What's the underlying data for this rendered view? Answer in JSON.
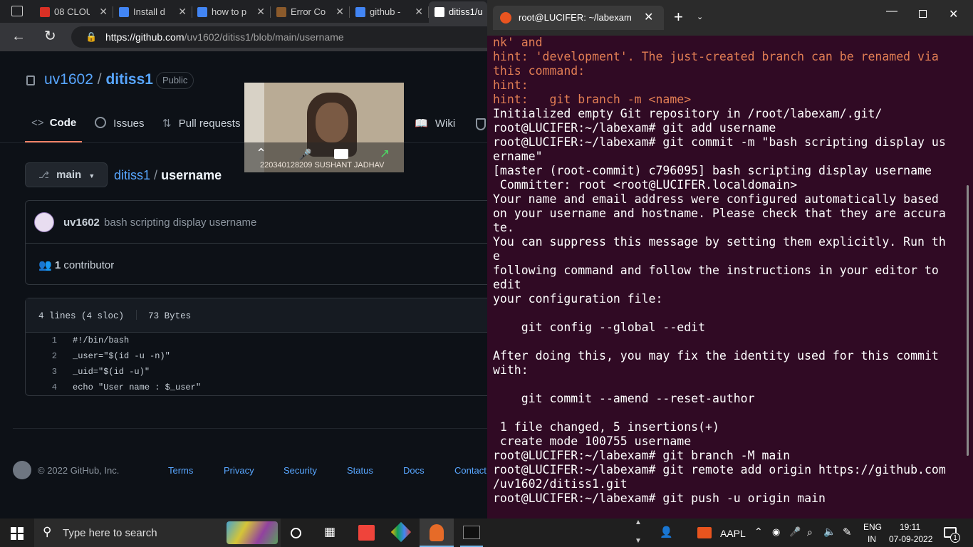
{
  "browser": {
    "tabs": [
      {
        "label": "08 CLOU",
        "icon": "pdf-icon",
        "color": "#d93025"
      },
      {
        "label": "Install d",
        "icon": "search-icon",
        "color": "#4285f4"
      },
      {
        "label": "how to p",
        "icon": "search-icon",
        "color": "#4285f4"
      },
      {
        "label": "Error Co",
        "icon": "page-icon",
        "color": "#8b5a2b"
      },
      {
        "label": "github -",
        "icon": "search-icon",
        "color": "#4285f4"
      },
      {
        "label": "ditiss1/u",
        "icon": "github-icon",
        "color": "#ffffff"
      }
    ],
    "url_host": "https://github.com",
    "url_path": "/uv1602/ditiss1/blob/main/username"
  },
  "github": {
    "owner": "uv1602",
    "sep": "/",
    "repo": "ditiss1",
    "visibility": "Public",
    "nav": {
      "code": "Code",
      "issues": "Issues",
      "pulls": "Pull requests",
      "wiki": "Wiki"
    },
    "branch": "main",
    "breadcrumb_repo": "ditiss1",
    "breadcrumb_file": "username",
    "commit_author": "uv1602",
    "commit_message": "bash scripting display username",
    "contributors_count": "1",
    "contributors_label": "contributor",
    "file_lines": "4 lines (4 sloc)",
    "file_size": "73 Bytes",
    "code": [
      {
        "n": "1",
        "text": "#!/bin/bash"
      },
      {
        "n": "2",
        "text": "_user=\"$(id -u -n)\""
      },
      {
        "n": "3",
        "text": "_uid=\"$(id -u)\""
      },
      {
        "n": "4",
        "text": "echo \"User name : $_user\""
      }
    ],
    "footer": {
      "copyright": "© 2022 GitHub, Inc.",
      "links": [
        "Terms",
        "Privacy",
        "Security",
        "Status",
        "Docs",
        "Contact"
      ]
    }
  },
  "video": {
    "caption": "220340128209 SUSHANT JADHAV"
  },
  "terminal": {
    "title": "root@LUCIFER: ~/labexam",
    "lines": [
      {
        "t": "nk' and",
        "c": "hint"
      },
      {
        "t": "hint: 'development'. The just-created branch can be renamed via",
        "c": "hint"
      },
      {
        "t": "this command:",
        "c": "hint"
      },
      {
        "t": "hint:",
        "c": "hint"
      },
      {
        "t": "hint:   git branch -m <name>",
        "c": "hint"
      },
      {
        "t": "Initialized empty Git repository in /root/labexam/.git/",
        "c": "out"
      },
      {
        "t": "root@LUCIFER:~/labexam# git add username",
        "c": "out"
      },
      {
        "t": "root@LUCIFER:~/labexam# git commit -m \"bash scripting display us",
        "c": "out"
      },
      {
        "t": "ername\"",
        "c": "out"
      },
      {
        "t": "[master (root-commit) c796095] bash scripting display username",
        "c": "out"
      },
      {
        "t": " Committer: root <root@LUCIFER.localdomain>",
        "c": "out"
      },
      {
        "t": "Your name and email address were configured automatically based",
        "c": "out"
      },
      {
        "t": "on your username and hostname. Please check that they are accura",
        "c": "out"
      },
      {
        "t": "te.",
        "c": "out"
      },
      {
        "t": "You can suppress this message by setting them explicitly. Run th",
        "c": "out"
      },
      {
        "t": "e",
        "c": "out"
      },
      {
        "t": "following command and follow the instructions in your editor to",
        "c": "out"
      },
      {
        "t": "edit",
        "c": "out"
      },
      {
        "t": "your configuration file:",
        "c": "out"
      },
      {
        "t": "",
        "c": "out"
      },
      {
        "t": "    git config --global --edit",
        "c": "out"
      },
      {
        "t": "",
        "c": "out"
      },
      {
        "t": "After doing this, you may fix the identity used for this commit",
        "c": "out"
      },
      {
        "t": "with:",
        "c": "out"
      },
      {
        "t": "",
        "c": "out"
      },
      {
        "t": "    git commit --amend --reset-author",
        "c": "out"
      },
      {
        "t": "",
        "c": "out"
      },
      {
        "t": " 1 file changed, 5 insertions(+)",
        "c": "out"
      },
      {
        "t": " create mode 100755 username",
        "c": "out"
      },
      {
        "t": "root@LUCIFER:~/labexam# git branch -M main",
        "c": "out"
      },
      {
        "t": "root@LUCIFER:~/labexam# git remote add origin https://github.com",
        "c": "out"
      },
      {
        "t": "/uv1602/ditiss1.git",
        "c": "out"
      },
      {
        "t": "root@LUCIFER:~/labexam# git push -u origin main",
        "c": "out"
      }
    ],
    "colors": {
      "bg": "#300a24",
      "hint": "#e27e54",
      "text": "#ffffff"
    }
  },
  "taskbar": {
    "search_placeholder": "Type here to search",
    "stock": "AAPL",
    "lang_top": "ENG",
    "lang_bottom": "IN",
    "time": "19:11",
    "date": "07-09-2022",
    "notifications": "1"
  }
}
